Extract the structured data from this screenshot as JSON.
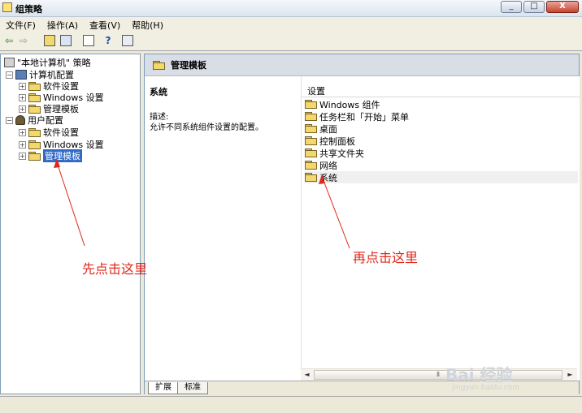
{
  "window": {
    "title": "组策略",
    "buttons": [
      "_",
      "□",
      "X"
    ]
  },
  "menu": [
    "文件(F)",
    "操作(A)",
    "查看(V)",
    "帮助(H)"
  ],
  "toolbar": [
    "back-icon",
    "forward-icon",
    "up-folder-icon",
    "show-hide-tree-icon",
    "export-list-icon",
    "help-icon",
    "properties-icon"
  ],
  "tree": {
    "root": "\"本地计算机\" 策略",
    "computer": {
      "label": "计算机配置",
      "children": [
        "软件设置",
        "Windows 设置",
        "管理模板"
      ]
    },
    "user": {
      "label": "用户配置",
      "children": [
        "软件设置",
        "Windows 设置",
        "管理模板"
      ]
    }
  },
  "right": {
    "header": "管理模板",
    "desc_title": "系统",
    "desc_label": "描述:",
    "desc_text": "允许不同系统组件设置的配置。",
    "column": "设置",
    "items": [
      "Windows 组件",
      "任务栏和「开始」菜单",
      "桌面",
      "控制面板",
      "共享文件夹",
      "网络",
      "系统"
    ]
  },
  "tabs": [
    "扩展",
    "标准"
  ],
  "annotations": {
    "left": "先点击这里",
    "right": "再点击这里"
  },
  "watermark": {
    "logo": "Bai 经验",
    "url": "jingyan.baidu.com"
  },
  "colors": {
    "annotation": "#e0281d",
    "selection": "#316ac5"
  }
}
